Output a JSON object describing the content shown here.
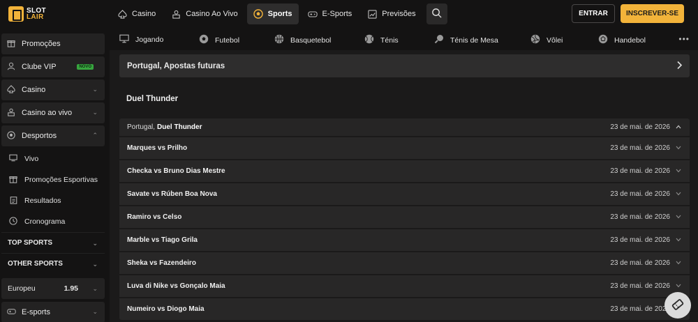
{
  "brand": {
    "line1": "SLOT",
    "line2": "LAIR",
    "accent": "#f2b33a"
  },
  "topnav": [
    {
      "label": "Casino",
      "icon": "spade-icon"
    },
    {
      "label": "Casino Ao Vivo",
      "icon": "dealer-icon"
    },
    {
      "label": "Sports",
      "icon": "soccer-ball-icon",
      "active": true
    },
    {
      "label": "E-Sports",
      "icon": "gamepad-icon"
    },
    {
      "label": "Previsões",
      "icon": "chart-icon"
    }
  ],
  "auth": {
    "login": "ENTRAR",
    "signup": "INSCREVER-SE"
  },
  "sidebar": {
    "items": [
      {
        "label": "Promoções",
        "icon": "gift-icon"
      },
      {
        "label": "Clube VIP",
        "icon": "user-icon",
        "badge": "NOVO"
      },
      {
        "label": "Casino",
        "icon": "spade-icon"
      },
      {
        "label": "Casino ao vivo",
        "icon": "dealer-icon"
      },
      {
        "label": "Desportos",
        "icon": "soccer-ball-icon"
      }
    ],
    "subitems": [
      {
        "label": "Vivo",
        "icon": "live-tv-icon"
      },
      {
        "label": "Promoções Esportivas",
        "icon": "gift-icon"
      },
      {
        "label": "Resultados",
        "icon": "clipboard-icon"
      },
      {
        "label": "Cronograma",
        "icon": "clock-icon"
      }
    ],
    "sections": [
      "TOP SPORTS",
      "OTHER SPORTS"
    ],
    "odds_format": {
      "label": "Europeu",
      "value": "1.95"
    },
    "esports": "E-sports"
  },
  "sportsbar": [
    {
      "label": "Jogando",
      "icon": "monitor-icon"
    },
    {
      "label": "Futebol",
      "icon": "soccer-ball-icon"
    },
    {
      "label": "Basquetebol",
      "icon": "basketball-icon"
    },
    {
      "label": "Ténis",
      "icon": "tennis-ball-icon"
    },
    {
      "label": "Ténis de Mesa",
      "icon": "ping-pong-icon"
    },
    {
      "label": "Vôlei",
      "icon": "volleyball-icon"
    },
    {
      "label": "Handebol",
      "icon": "handball-icon"
    }
  ],
  "main": {
    "future_bets": "Portugal, Apostas futuras",
    "league_title": "Duel Thunder",
    "league_head": {
      "country": "Portugal,",
      "league": "Duel Thunder",
      "date": "23 de mai. de 2026"
    },
    "matches": [
      {
        "name": "Marques vs Prilho",
        "date": "23 de mai. de 2026"
      },
      {
        "name": "Checka vs Bruno Dias Mestre",
        "date": "23 de mai. de 2026"
      },
      {
        "name": "Savate vs Rúben Boa Nova",
        "date": "23 de mai. de 2026"
      },
      {
        "name": "Ramiro vs Celso",
        "date": "23 de mai. de 2026"
      },
      {
        "name": "Marble vs Tiago Grila",
        "date": "23 de mai. de 2026"
      },
      {
        "name": "Sheka vs Fazendeiro",
        "date": "23 de mai. de 2026"
      },
      {
        "name": "Luva di Nike vs Gonçalo Maia",
        "date": "23 de mai. de 2026"
      },
      {
        "name": "Numeiro vs Diogo Maia",
        "date": "23 de mai. de 2026"
      }
    ]
  }
}
